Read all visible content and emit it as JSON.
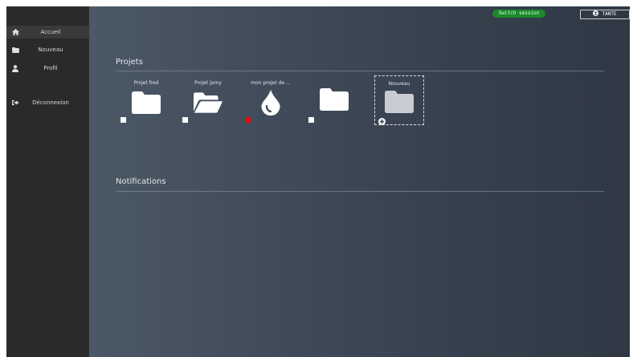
{
  "topbar": {
    "switch_label": "Switch session",
    "user_label": "TANTE"
  },
  "sidebar": {
    "items": [
      {
        "label": "Accueil",
        "icon": "home-icon"
      },
      {
        "label": "Nouveau",
        "icon": "folder-icon"
      },
      {
        "label": "Profil",
        "icon": "user-icon"
      },
      {
        "label": "Déconnexion",
        "icon": "logout-icon"
      }
    ]
  },
  "projects": {
    "title": "Projets",
    "items": [
      {
        "name": "Projet fred",
        "icon": "folder-icon",
        "marker_color": "#ffffff"
      },
      {
        "name": "Projet Jamy",
        "icon": "folder-open-icon",
        "marker_color": "#ffffff"
      },
      {
        "name": "mon projet de ...",
        "icon": "drop-icon",
        "marker_color": "#e01010"
      },
      {
        "name": "",
        "icon": "folder-icon",
        "marker_color": "#ffffff"
      }
    ],
    "new_label": "Nouveau"
  },
  "notifications": {
    "title": "Notifications"
  },
  "colors": {
    "switch_bg": "#1a8a2a",
    "sidebar_bg": "#2a2a2a",
    "main_bg_left": "#4b5866",
    "main_bg_right": "#2f3844"
  }
}
